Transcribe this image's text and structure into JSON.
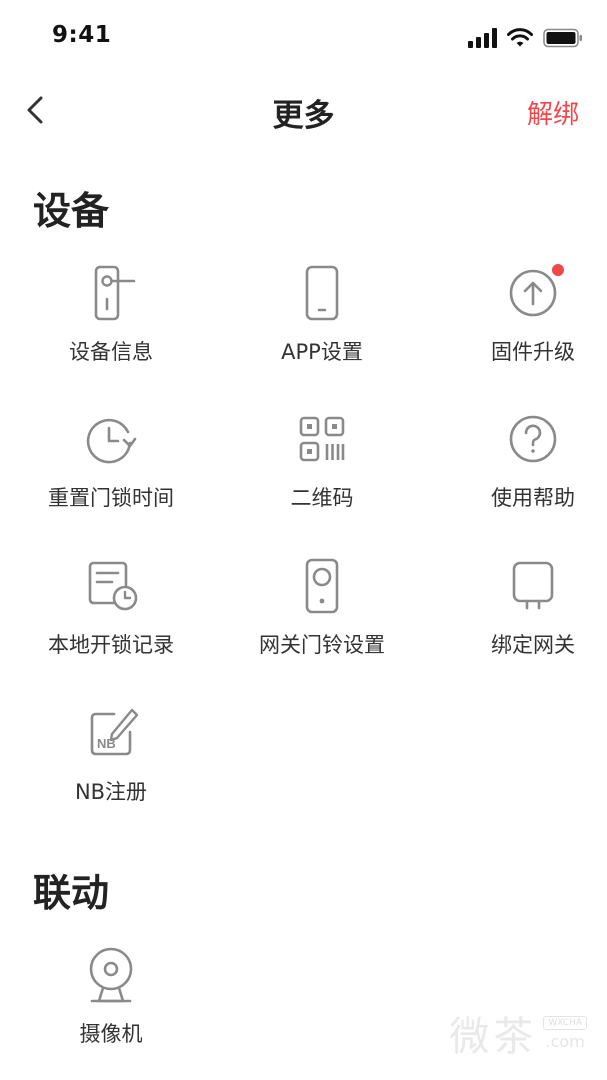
{
  "status_bar": {
    "time": "9:41"
  },
  "nav": {
    "title": "更多",
    "action_label": "解绑"
  },
  "colors": {
    "accent": "#f2474a",
    "icon_stroke": "#8a8a8a",
    "text": "#333333"
  },
  "sections": [
    {
      "title": "设备",
      "items": [
        {
          "label": "设备信息",
          "icon": "door-lock-icon"
        },
        {
          "label": "APP设置",
          "icon": "phone-icon"
        },
        {
          "label": "固件升级",
          "icon": "upgrade-arrow-icon",
          "badge": true
        },
        {
          "label": "重置门锁时间",
          "icon": "clock-reset-icon"
        },
        {
          "label": "二维码",
          "icon": "qr-code-icon"
        },
        {
          "label": "使用帮助",
          "icon": "help-icon"
        },
        {
          "label": "本地开锁记录",
          "icon": "record-clock-icon"
        },
        {
          "label": "网关门铃设置",
          "icon": "doorbell-icon"
        },
        {
          "label": "绑定网关",
          "icon": "gateway-icon"
        },
        {
          "label": "NB注册",
          "icon": "nb-register-icon"
        }
      ]
    },
    {
      "title": "联动",
      "items": [
        {
          "label": "摄像机",
          "icon": "camera-icon"
        }
      ]
    }
  ],
  "watermark": {
    "text": "微茶",
    "badge": "WXCHA",
    "url": ".com"
  }
}
